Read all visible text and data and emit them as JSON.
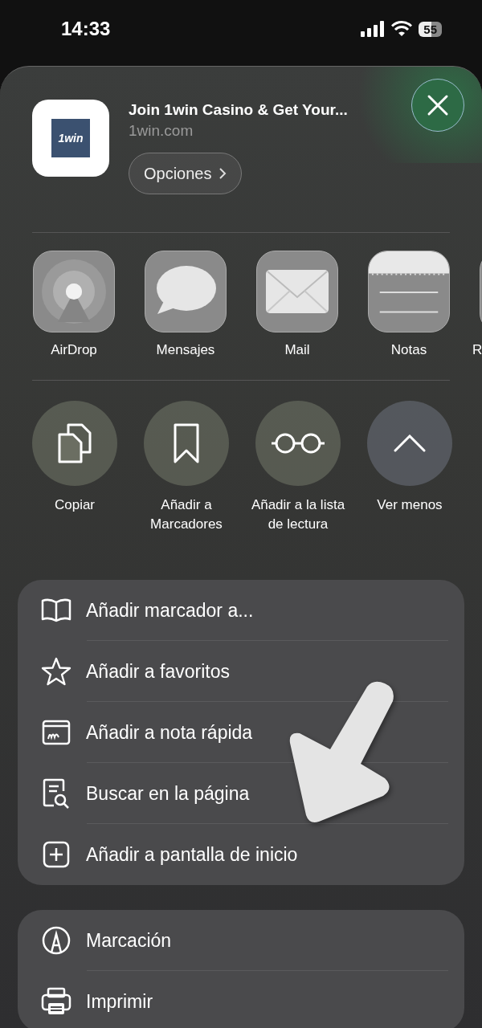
{
  "status_bar": {
    "time": "14:33",
    "battery": "55"
  },
  "header": {
    "title": "Join 1win Casino & Get Your...",
    "domain": "1win.com",
    "app_logo": "1win",
    "options_button": "Opciones"
  },
  "apps": [
    {
      "kind": "airdrop",
      "label": "AirDrop"
    },
    {
      "kind": "messages",
      "label": "Mensajes"
    },
    {
      "kind": "mail",
      "label": "Mail"
    },
    {
      "kind": "notes",
      "label": "Notas"
    },
    {
      "kind": "partial",
      "label": "R"
    }
  ],
  "actions": [
    {
      "kind": "copy",
      "label": "Copiar"
    },
    {
      "kind": "bookmark",
      "label": "Añadir a Marcadores"
    },
    {
      "kind": "glasses",
      "label": "Añadir a la lista de lectura"
    },
    {
      "kind": "chevron",
      "label": "Ver menos"
    }
  ],
  "menu_groups": [
    [
      {
        "kind": "book",
        "label": "Añadir marcador a..."
      },
      {
        "kind": "star",
        "label": "Añadir a favoritos"
      },
      {
        "kind": "note",
        "label": "Añadir a nota rápida"
      },
      {
        "kind": "find",
        "label": "Buscar en la página"
      },
      {
        "kind": "plus",
        "label": "Añadir a pantalla de inicio"
      }
    ],
    [
      {
        "kind": "markup",
        "label": "Marcación"
      },
      {
        "kind": "print",
        "label": "Imprimir"
      }
    ]
  ]
}
